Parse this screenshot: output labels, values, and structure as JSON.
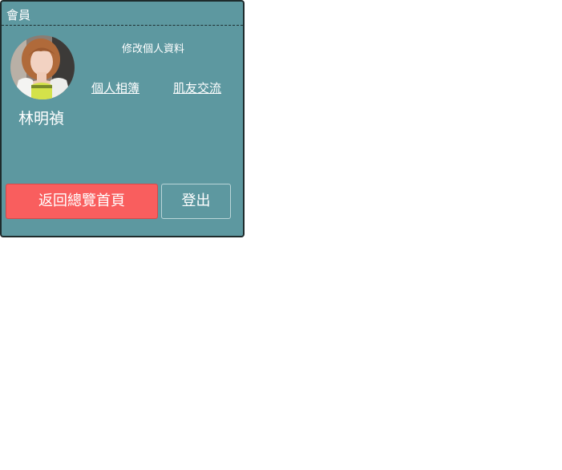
{
  "panel": {
    "title": "會員"
  },
  "member": {
    "name": "林明禎",
    "avatar_alt": "member-avatar-photo"
  },
  "links": {
    "edit_profile": "修改個人資料",
    "album": "個人相簿",
    "friends": "肌友交流"
  },
  "buttons": {
    "home": "返回總覽首頁",
    "logout": "登出"
  },
  "colors": {
    "panel_bg": "#5d98a0",
    "panel_border": "#1e2b2c",
    "home_button": "#f95e5e",
    "text": "#ffffff"
  }
}
